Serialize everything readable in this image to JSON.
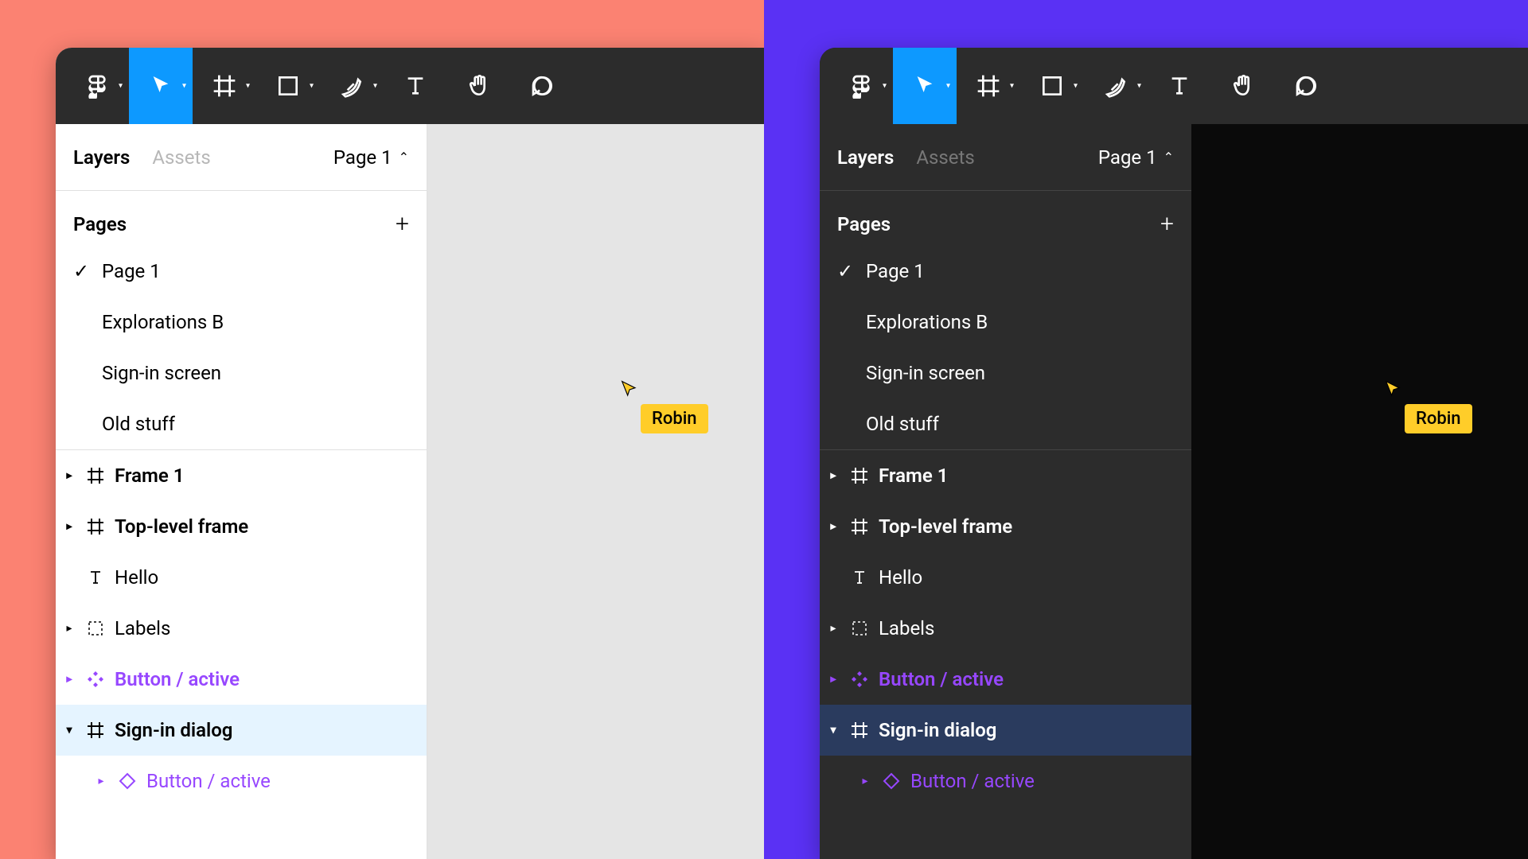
{
  "themes": [
    {
      "id": "light",
      "bgClass": "half-left"
    },
    {
      "id": "dark",
      "bgClass": "half-right"
    }
  ],
  "toolbar": {
    "tools": [
      {
        "name": "figma-menu-icon",
        "chevron": true
      },
      {
        "name": "move-tool-icon",
        "chevron": true,
        "active": true
      },
      {
        "name": "frame-tool-icon",
        "chevron": true
      },
      {
        "name": "shape-tool-icon",
        "chevron": true
      },
      {
        "name": "pen-tool-icon",
        "chevron": true
      },
      {
        "name": "text-tool-icon",
        "chevron": false
      },
      {
        "name": "hand-tool-icon",
        "chevron": false
      },
      {
        "name": "comment-tool-icon",
        "chevron": false
      }
    ]
  },
  "sidebar": {
    "tabs": {
      "layers": "Layers",
      "assets": "Assets"
    },
    "page_selector": "Page 1",
    "pages_label": "Pages",
    "pages": [
      {
        "name": "Page 1",
        "active": true
      },
      {
        "name": "Explorations B"
      },
      {
        "name": "Sign-in screen"
      },
      {
        "name": "Old stuff"
      }
    ],
    "layers": [
      {
        "name": "Frame 1",
        "icon": "frame",
        "bold": true,
        "disclosure": "closed"
      },
      {
        "name": "Top-level frame",
        "icon": "frame",
        "bold": true,
        "disclosure": "closed"
      },
      {
        "name": "Hello",
        "icon": "text",
        "bold": false,
        "disclosure": "none"
      },
      {
        "name": "Labels",
        "icon": "group",
        "bold": false,
        "disclosure": "closed"
      },
      {
        "name": "Button / active",
        "icon": "component",
        "bold": false,
        "disclosure": "closed",
        "kind": "component"
      },
      {
        "name": "Sign-in dialog",
        "icon": "frame",
        "bold": true,
        "disclosure": "open",
        "selected": true
      },
      {
        "name": "Button / active",
        "icon": "instance",
        "bold": false,
        "disclosure": "closed",
        "kind": "instance",
        "nested": true
      }
    ]
  },
  "collaborator": {
    "name": "Robin",
    "color": "#ffcd29"
  }
}
